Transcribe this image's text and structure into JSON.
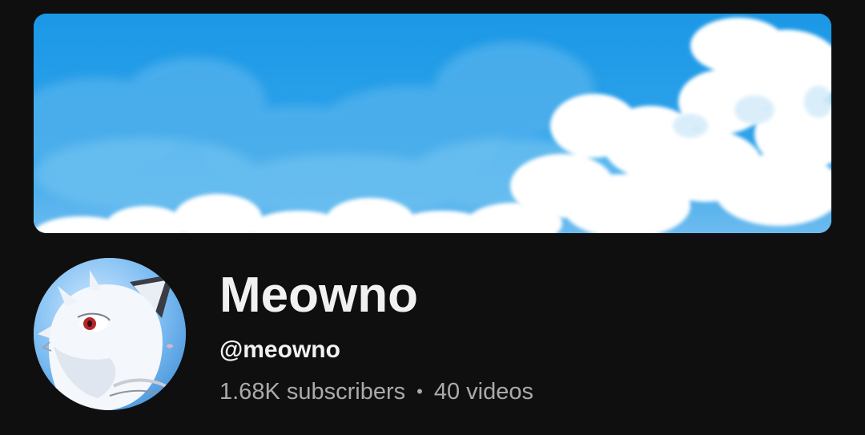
{
  "channel": {
    "name": "Meowno",
    "handle": "@meowno",
    "subscribers": "1.68K subscribers",
    "separator": "•",
    "videos": "40 videos"
  },
  "banner": {
    "description_icon": "sky-clouds-banner",
    "sky_color": "#1e9be8"
  },
  "avatar": {
    "icon": "white-wolf-avatar-icon"
  },
  "colors": {
    "background": "#0f0f0f",
    "primary_text": "#f1f1f1",
    "secondary_text": "#aaaaaa"
  }
}
